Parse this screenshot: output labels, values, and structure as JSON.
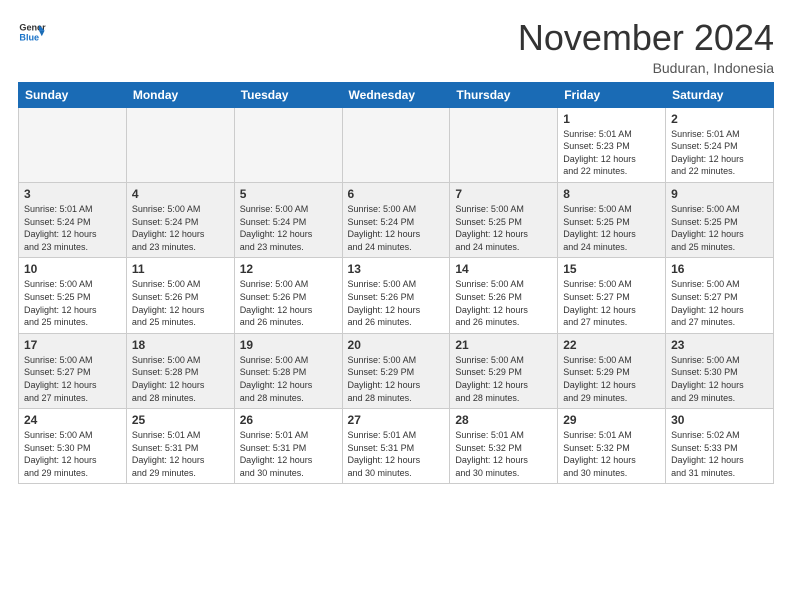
{
  "header": {
    "logo_line1": "General",
    "logo_line2": "Blue",
    "month": "November 2024",
    "location": "Buduran, Indonesia"
  },
  "days_of_week": [
    "Sunday",
    "Monday",
    "Tuesday",
    "Wednesday",
    "Thursday",
    "Friday",
    "Saturday"
  ],
  "weeks": [
    [
      {
        "day": "",
        "info": ""
      },
      {
        "day": "",
        "info": ""
      },
      {
        "day": "",
        "info": ""
      },
      {
        "day": "",
        "info": ""
      },
      {
        "day": "",
        "info": ""
      },
      {
        "day": "1",
        "info": "Sunrise: 5:01 AM\nSunset: 5:23 PM\nDaylight: 12 hours\nand 22 minutes."
      },
      {
        "day": "2",
        "info": "Sunrise: 5:01 AM\nSunset: 5:24 PM\nDaylight: 12 hours\nand 22 minutes."
      }
    ],
    [
      {
        "day": "3",
        "info": "Sunrise: 5:01 AM\nSunset: 5:24 PM\nDaylight: 12 hours\nand 23 minutes."
      },
      {
        "day": "4",
        "info": "Sunrise: 5:00 AM\nSunset: 5:24 PM\nDaylight: 12 hours\nand 23 minutes."
      },
      {
        "day": "5",
        "info": "Sunrise: 5:00 AM\nSunset: 5:24 PM\nDaylight: 12 hours\nand 23 minutes."
      },
      {
        "day": "6",
        "info": "Sunrise: 5:00 AM\nSunset: 5:24 PM\nDaylight: 12 hours\nand 24 minutes."
      },
      {
        "day": "7",
        "info": "Sunrise: 5:00 AM\nSunset: 5:25 PM\nDaylight: 12 hours\nand 24 minutes."
      },
      {
        "day": "8",
        "info": "Sunrise: 5:00 AM\nSunset: 5:25 PM\nDaylight: 12 hours\nand 24 minutes."
      },
      {
        "day": "9",
        "info": "Sunrise: 5:00 AM\nSunset: 5:25 PM\nDaylight: 12 hours\nand 25 minutes."
      }
    ],
    [
      {
        "day": "10",
        "info": "Sunrise: 5:00 AM\nSunset: 5:25 PM\nDaylight: 12 hours\nand 25 minutes."
      },
      {
        "day": "11",
        "info": "Sunrise: 5:00 AM\nSunset: 5:26 PM\nDaylight: 12 hours\nand 25 minutes."
      },
      {
        "day": "12",
        "info": "Sunrise: 5:00 AM\nSunset: 5:26 PM\nDaylight: 12 hours\nand 26 minutes."
      },
      {
        "day": "13",
        "info": "Sunrise: 5:00 AM\nSunset: 5:26 PM\nDaylight: 12 hours\nand 26 minutes."
      },
      {
        "day": "14",
        "info": "Sunrise: 5:00 AM\nSunset: 5:26 PM\nDaylight: 12 hours\nand 26 minutes."
      },
      {
        "day": "15",
        "info": "Sunrise: 5:00 AM\nSunset: 5:27 PM\nDaylight: 12 hours\nand 27 minutes."
      },
      {
        "day": "16",
        "info": "Sunrise: 5:00 AM\nSunset: 5:27 PM\nDaylight: 12 hours\nand 27 minutes."
      }
    ],
    [
      {
        "day": "17",
        "info": "Sunrise: 5:00 AM\nSunset: 5:27 PM\nDaylight: 12 hours\nand 27 minutes."
      },
      {
        "day": "18",
        "info": "Sunrise: 5:00 AM\nSunset: 5:28 PM\nDaylight: 12 hours\nand 28 minutes."
      },
      {
        "day": "19",
        "info": "Sunrise: 5:00 AM\nSunset: 5:28 PM\nDaylight: 12 hours\nand 28 minutes."
      },
      {
        "day": "20",
        "info": "Sunrise: 5:00 AM\nSunset: 5:29 PM\nDaylight: 12 hours\nand 28 minutes."
      },
      {
        "day": "21",
        "info": "Sunrise: 5:00 AM\nSunset: 5:29 PM\nDaylight: 12 hours\nand 28 minutes."
      },
      {
        "day": "22",
        "info": "Sunrise: 5:00 AM\nSunset: 5:29 PM\nDaylight: 12 hours\nand 29 minutes."
      },
      {
        "day": "23",
        "info": "Sunrise: 5:00 AM\nSunset: 5:30 PM\nDaylight: 12 hours\nand 29 minutes."
      }
    ],
    [
      {
        "day": "24",
        "info": "Sunrise: 5:00 AM\nSunset: 5:30 PM\nDaylight: 12 hours\nand 29 minutes."
      },
      {
        "day": "25",
        "info": "Sunrise: 5:01 AM\nSunset: 5:31 PM\nDaylight: 12 hours\nand 29 minutes."
      },
      {
        "day": "26",
        "info": "Sunrise: 5:01 AM\nSunset: 5:31 PM\nDaylight: 12 hours\nand 30 minutes."
      },
      {
        "day": "27",
        "info": "Sunrise: 5:01 AM\nSunset: 5:31 PM\nDaylight: 12 hours\nand 30 minutes."
      },
      {
        "day": "28",
        "info": "Sunrise: 5:01 AM\nSunset: 5:32 PM\nDaylight: 12 hours\nand 30 minutes."
      },
      {
        "day": "29",
        "info": "Sunrise: 5:01 AM\nSunset: 5:32 PM\nDaylight: 12 hours\nand 30 minutes."
      },
      {
        "day": "30",
        "info": "Sunrise: 5:02 AM\nSunset: 5:33 PM\nDaylight: 12 hours\nand 31 minutes."
      }
    ]
  ]
}
